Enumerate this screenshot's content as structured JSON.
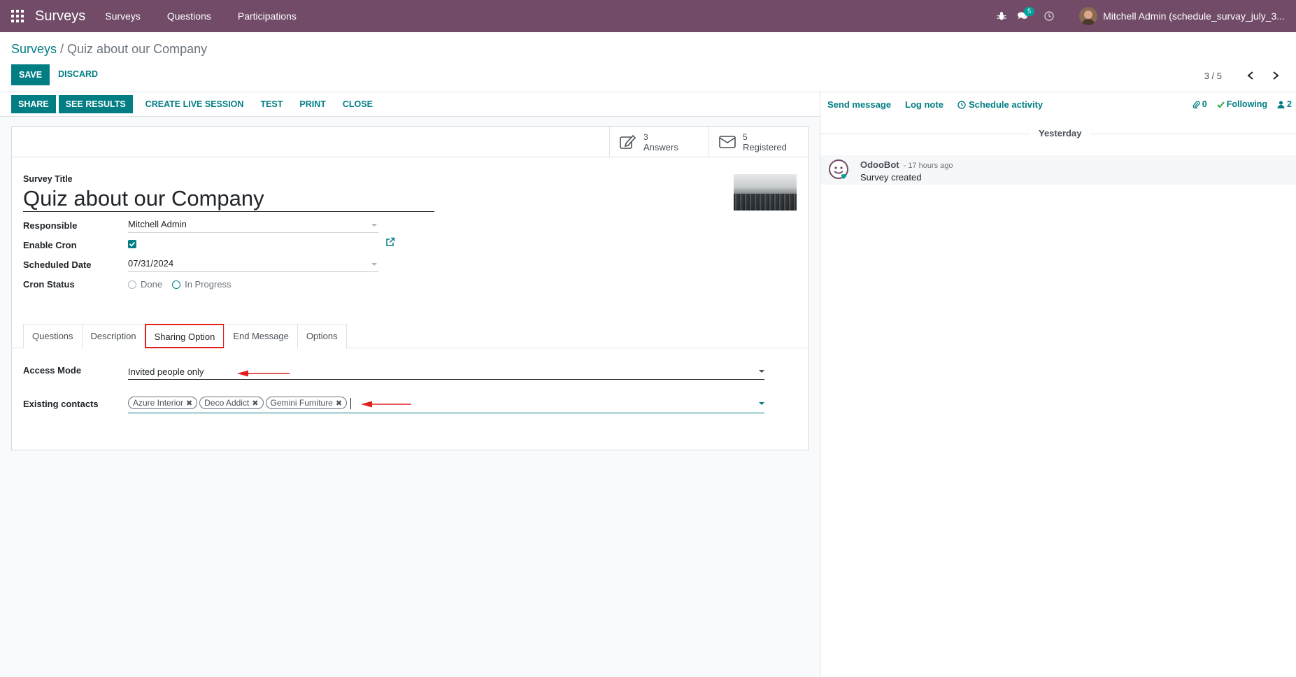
{
  "topbar": {
    "app_name": "Surveys",
    "menu": [
      "Surveys",
      "Questions",
      "Participations"
    ],
    "chat_count": "5",
    "user_name": "Mitchell Admin (schedule_survay_july_3..."
  },
  "control_panel": {
    "breadcrumb_parent": "Surveys",
    "breadcrumb_sep": " / ",
    "breadcrumb_current": "Quiz about our Company",
    "save_label": "SAVE",
    "discard_label": "DISCARD",
    "pager": "3 / 5"
  },
  "statusbar": {
    "share": "SHARE",
    "see_results": "SEE RESULTS",
    "create_live_session": "CREATE LIVE SESSION",
    "test": "TEST",
    "print": "PRINT",
    "close": "CLOSE"
  },
  "smart_buttons": {
    "answers_count": "3",
    "answers_label": "Answers",
    "registered_count": "5",
    "registered_label": "Registered"
  },
  "form": {
    "title_label": "Survey Title",
    "title_value": "Quiz about our Company",
    "responsible_label": "Responsible",
    "responsible_value": "Mitchell Admin",
    "enable_cron_label": "Enable Cron",
    "scheduled_date_label": "Scheduled Date",
    "scheduled_date_value": "07/31/2024",
    "cron_status_label": "Cron Status",
    "cron_status_options": [
      "Done",
      "In Progress"
    ]
  },
  "tabs": [
    "Questions",
    "Description",
    "Sharing Option",
    "End Message",
    "Options"
  ],
  "sharing": {
    "access_mode_label": "Access Mode",
    "access_mode_value": "Invited people only",
    "existing_contacts_label": "Existing contacts",
    "contacts": [
      "Azure Interior",
      "Deco Addict",
      "Gemini Furniture"
    ]
  },
  "chatter": {
    "send_message": "Send message",
    "log_note": "Log note",
    "schedule_activity": "Schedule activity",
    "attachments_count": "0",
    "following": "Following",
    "followers_count": "2",
    "day": "Yesterday",
    "message_author": "OdooBot",
    "message_time": "- 17 hours ago",
    "message_body": "Survey created"
  },
  "colors": {
    "brand": "#714b67",
    "primary": "#017e84",
    "annotation": "#e0201d"
  }
}
